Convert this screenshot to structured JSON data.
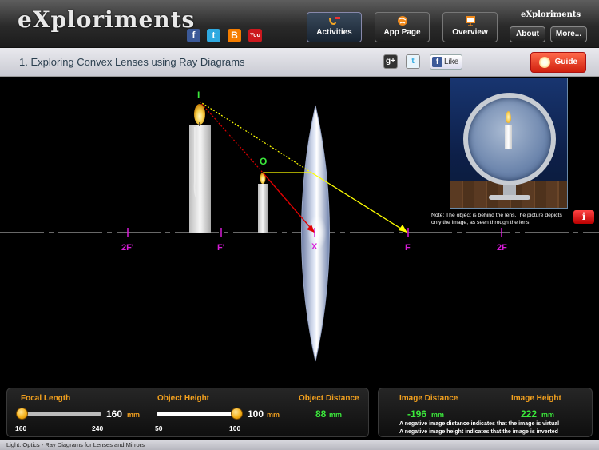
{
  "header": {
    "logo": "eXploriments",
    "brand_small": "eXploriments",
    "social": [
      {
        "name": "facebook-icon",
        "glyph": "f",
        "color": "#3b5998"
      },
      {
        "name": "twitter-icon",
        "glyph": "t",
        "color": "#2fa9e0"
      },
      {
        "name": "blogger-icon",
        "glyph": "B",
        "color": "#f57d00"
      },
      {
        "name": "youtube-icon",
        "glyph": "You",
        "color": "#cc181e"
      }
    ],
    "nav": [
      {
        "label": "Activities",
        "active": true
      },
      {
        "label": "App Page",
        "active": false
      },
      {
        "label": "Overview",
        "active": false
      }
    ],
    "about_label": "About",
    "more_label": "More..."
  },
  "titlebar": {
    "title": "1.  Exploring Convex Lenses using Ray Diagrams",
    "google_plus": "g+",
    "twitter": "t",
    "like_label": "Like",
    "guide_label": "Guide"
  },
  "diagram": {
    "labels": {
      "two_f_left": "2F'",
      "f_left": "F'",
      "x": "X",
      "f_right": "F",
      "two_f_right": "2F",
      "image": "I",
      "object": "O"
    },
    "note": "Note: The object is behind the lens.The picture depicts only the image, as seen through the lens.",
    "info_label": "i"
  },
  "controls": {
    "focal_length": {
      "label": "Focal Length",
      "value": "160",
      "unit": "mm",
      "min": "160",
      "max": "240",
      "fraction": 0.0
    },
    "object_height": {
      "label": "Object Height",
      "value": "100",
      "unit": "mm",
      "min": "50",
      "max": "100",
      "fraction": 1.0
    },
    "object_distance": {
      "label": "Object Distance",
      "value": "88",
      "unit": "mm"
    },
    "image_distance": {
      "label": "Image Distance",
      "value": "-196",
      "unit": "mm"
    },
    "image_height": {
      "label": "Image Height",
      "value": "222",
      "unit": "mm"
    },
    "note_1": "A negative image distance indicates that the image is virtual",
    "note_2": "A negative image height indicates that the image is inverted"
  },
  "footer": "Light: Optics - Ray Diagrams for Lenses and Mirrors",
  "colors": {
    "axis_labels": "#d91cd9",
    "point_labels": "#3be83b",
    "control_labels": "#f2a01e",
    "ray_yellow": "#ffff00",
    "ray_red": "#e00000"
  }
}
